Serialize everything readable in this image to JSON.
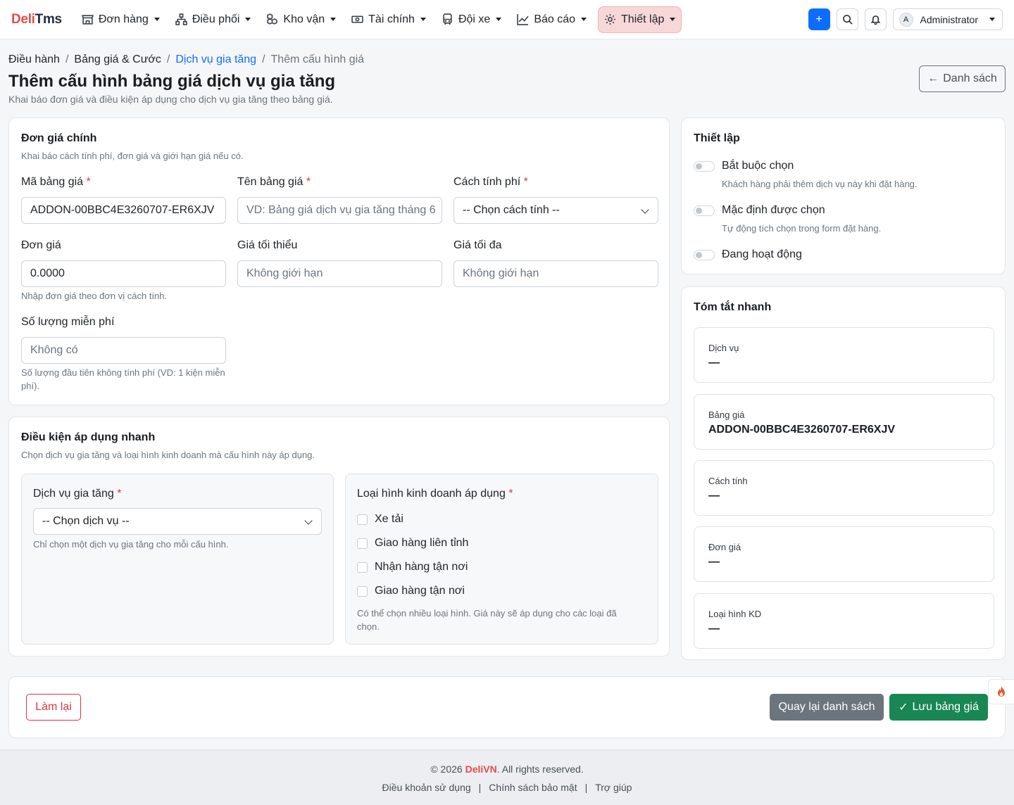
{
  "brand": {
    "part1": "Deli",
    "part2": "Tms"
  },
  "nav": {
    "items": [
      {
        "label": "Đơn hàng",
        "icon": "store-icon"
      },
      {
        "label": "Điều phối",
        "icon": "network-icon"
      },
      {
        "label": "Kho vận",
        "icon": "boxes-icon"
      },
      {
        "label": "Tài chính",
        "icon": "cash-icon"
      },
      {
        "label": "Đội xe",
        "icon": "bus-icon"
      },
      {
        "label": "Báo cáo",
        "icon": "chart-line-icon"
      },
      {
        "label": "Thiết lập",
        "icon": "gear-icon"
      }
    ],
    "add_label": "+",
    "user": {
      "initial": "A",
      "name": "Administrator"
    }
  },
  "breadcrumb": [
    "Điều hành",
    "Bảng giá & Cước",
    "Dịch vụ gia tăng",
    "Thêm cấu hình giá"
  ],
  "header": {
    "title": "Thêm cấu hình bảng giá dịch vụ gia tăng",
    "subtitle": "Khai báo đơn giá và điều kiện áp dụng cho dịch vụ gia tăng theo bảng giá.",
    "back_label": "Danh sách"
  },
  "pricing": {
    "title": "Đơn giá chính",
    "subtitle": "Khai báo cách tính phí, đơn giá và giới hạn giá nếu có.",
    "code": {
      "label": "Mã bảng giá",
      "value": "ADDON-00BBC4E3260707-ER6XJV"
    },
    "name": {
      "label": "Tên bảng giá",
      "placeholder": "VD: Bảng giá dịch vụ gia tăng tháng 6"
    },
    "method": {
      "label": "Cách tính phí",
      "selected": "-- Chọn cách tính --"
    },
    "unit_price": {
      "label": "Đơn giá",
      "value": "0.0000",
      "hint": "Nhập đơn giá theo đơn vị cách tính."
    },
    "min_price": {
      "label": "Giá tối thiểu",
      "placeholder": "Không giới hạn"
    },
    "max_price": {
      "label": "Giá tối đa",
      "placeholder": "Không giới hạn"
    },
    "free_qty": {
      "label": "Số lượng miễn phí",
      "placeholder": "Không có",
      "hint": "Số lượng đầu tiên không tính phí (VD: 1 kiện miễn phí)."
    },
    "required_mark": "*"
  },
  "conditions": {
    "title": "Điều kiện áp dụng nhanh",
    "subtitle": "Chọn dịch vụ gia tăng và loại hình kinh doanh mà cấu hình này áp dụng.",
    "service": {
      "label": "Dịch vụ gia tăng",
      "selected": "-- Chọn dịch vụ --",
      "hint": "Chỉ chọn một dịch vụ gia tăng cho mỗi cấu hình."
    },
    "business": {
      "label": "Loại hình kinh doanh áp dụng",
      "options": [
        "Xe tải",
        "Giao hàng liên tỉnh",
        "Nhận hàng tận nơi",
        "Giao hàng tận nơi"
      ],
      "hint": "Có thể chọn nhiều loại hình. Giá này sẽ áp dụng cho các loại đã chọn."
    }
  },
  "settings": {
    "title": "Thiết lập",
    "toggles": [
      {
        "label": "Bắt buộc chọn",
        "hint": "Khách hàng phải thêm dịch vụ này khi đặt hàng.",
        "on": false
      },
      {
        "label": "Mặc định được chọn",
        "hint": "Tự động tích chọn trong form đặt hàng.",
        "on": false
      },
      {
        "label": "Đang hoạt động",
        "hint": "",
        "on": false
      }
    ]
  },
  "summary": {
    "title": "Tóm tắt nhanh",
    "items": [
      {
        "label": "Dịch vụ",
        "value": "—"
      },
      {
        "label": "Bảng giá",
        "value": "ADDON-00BBC4E3260707-ER6XJV"
      },
      {
        "label": "Cách tính",
        "value": "—"
      },
      {
        "label": "Đơn giá",
        "value": "—"
      },
      {
        "label": "Loại hình KD",
        "value": "—"
      }
    ]
  },
  "actions": {
    "reset": "Làm lại",
    "back": "Quay lại danh sách",
    "save": "Lưu bảng giá"
  },
  "footer": {
    "copyright_prefix": "© 2026 ",
    "copyright_brand": "DeliVN",
    "copyright_suffix": ". All rights reserved.",
    "links": [
      "Điều khoản sử dụng",
      "Chính sách bảo mật",
      "Trợ giúp"
    ]
  },
  "colors": {
    "primary": "#0d6efd",
    "brand_red": "#e84a4a",
    "success": "#198754",
    "danger": "#dc3545",
    "secondary": "#6c757d"
  }
}
